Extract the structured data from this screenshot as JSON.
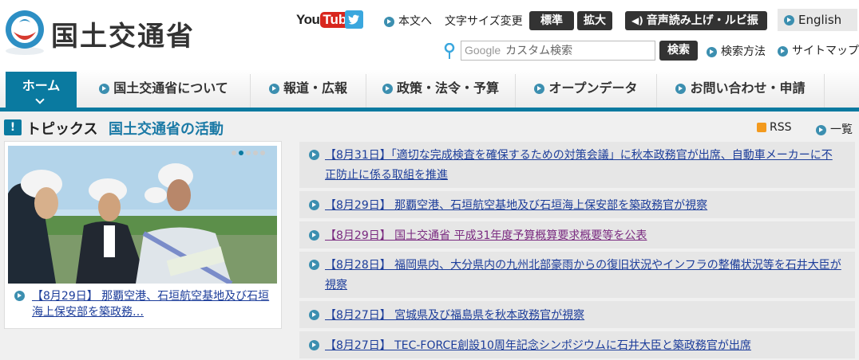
{
  "header": {
    "site_title": "国土交通省",
    "youtube_you": "You",
    "youtube_tube": "Tube",
    "main_text_link": "本文へ",
    "font_size_label": "文字サイズ変更",
    "font_standard": "標準",
    "font_large": "拡大",
    "voice_read": "音声読み上げ・ルビ振り",
    "english": "English",
    "search_google": "Google",
    "search_placeholder": "カスタム検索",
    "search_button": "検索",
    "search_method": "検索方法",
    "sitemap": "サイトマップ"
  },
  "nav": {
    "home": "ホーム",
    "items": [
      "国土交通省について",
      "報道・広報",
      "政策・法令・予算",
      "オープンデータ",
      "お問い合わせ・申請"
    ]
  },
  "topics": {
    "title": "トピックス",
    "subtitle": "国土交通省の活動",
    "rss": "RSS",
    "list_all": "一覧"
  },
  "feature": {
    "caption": "【8月29日】 那覇空港、石垣航空基地及び石垣海上保安部を築政務…"
  },
  "news": [
    {
      "text": "【8月31日】「適切な完成検査を確保するための対策会議」に秋本政務官が出席、自動車メーカーに不正防止に係る取組を推進"
    },
    {
      "text": "【8月29日】 那覇空港、石垣航空基地及び石垣海上保安部を築政務官が視察"
    },
    {
      "text": "【8月29日】 国土交通省 平成31年度予算概算要求概要等を公表"
    },
    {
      "text": "【8月28日】 福岡県内、大分県内の九州北部豪雨からの復旧状況やインフラの整備状況等を石井大臣が視察"
    },
    {
      "text": "【8月27日】 宮城県及び福島県を秋本政務官が視察"
    },
    {
      "text": "【8月27日】 TEC-FORCE創設10周年記念シンポジウムに石井大臣と築政務官が出席"
    }
  ],
  "colors": {
    "accent": "#0a7aa0",
    "link": "#1c3d9a",
    "visited": "#7a2a80",
    "youtube_red": "#d8261d",
    "twitter": "#3aa7de"
  }
}
